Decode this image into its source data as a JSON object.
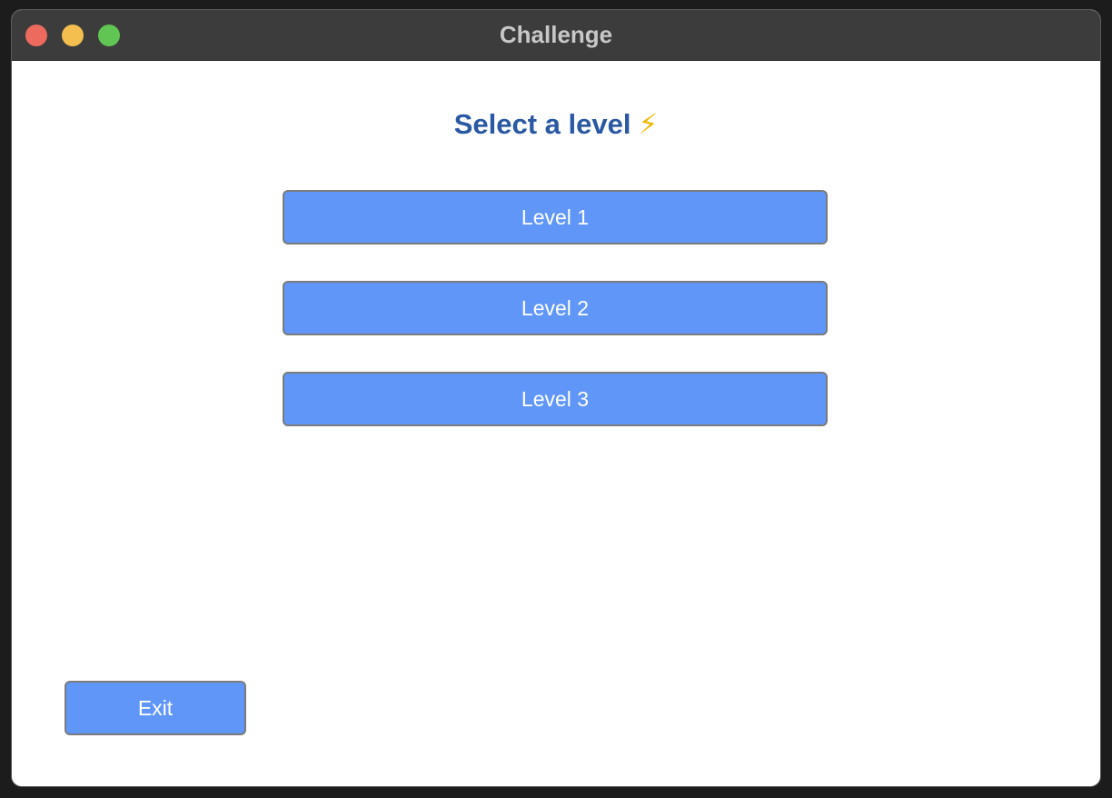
{
  "window": {
    "title": "Challenge",
    "controls": [
      "close",
      "minimize",
      "zoom"
    ]
  },
  "main": {
    "heading": "Select a level",
    "heading_icon": "⚡",
    "levels": [
      {
        "label": "Level 1"
      },
      {
        "label": "Level 2"
      },
      {
        "label": "Level 3"
      }
    ],
    "exit_label": "Exit"
  },
  "colors": {
    "button": "#6096f8",
    "heading": "#2a58a3",
    "titlebar": "#3c3c3c"
  }
}
